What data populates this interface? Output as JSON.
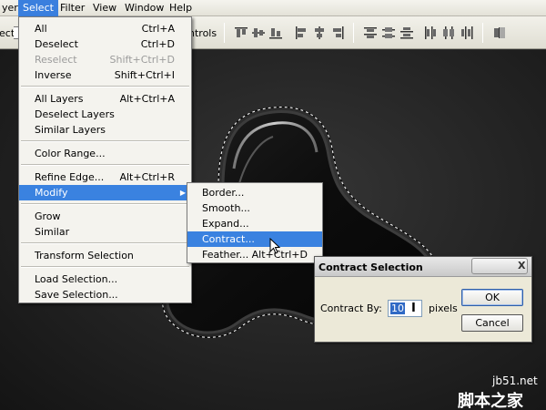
{
  "menubar": {
    "items": [
      {
        "label": "yer",
        "active": false
      },
      {
        "label": "Select",
        "active": true
      },
      {
        "label": "Filter",
        "active": false
      },
      {
        "label": "View",
        "active": false
      },
      {
        "label": "Window",
        "active": false
      },
      {
        "label": "Help",
        "active": false
      }
    ]
  },
  "toolbar": {
    "left_label": "ect:",
    "right_label": "ntrols"
  },
  "select_menu": {
    "items": [
      {
        "label": "All",
        "shortcut": "Ctrl+A"
      },
      {
        "label": "Deselect",
        "shortcut": "Ctrl+D"
      },
      {
        "label": "Reselect",
        "shortcut": "Shift+Ctrl+D"
      },
      {
        "label": "Inverse",
        "shortcut": "Shift+Ctrl+I"
      },
      {
        "label": "All Layers",
        "shortcut": "Alt+Ctrl+A"
      },
      {
        "label": "Deselect Layers",
        "shortcut": ""
      },
      {
        "label": "Similar Layers",
        "shortcut": ""
      },
      {
        "label": "Color Range...",
        "shortcut": ""
      },
      {
        "label": "Refine Edge...",
        "shortcut": "Alt+Ctrl+R"
      },
      {
        "label": "Modify",
        "shortcut": ""
      },
      {
        "label": "Grow",
        "shortcut": ""
      },
      {
        "label": "Similar",
        "shortcut": ""
      },
      {
        "label": "Transform Selection",
        "shortcut": ""
      },
      {
        "label": "Load Selection...",
        "shortcut": ""
      },
      {
        "label": "Save Selection...",
        "shortcut": ""
      }
    ]
  },
  "modify_menu": {
    "items": [
      {
        "label": "Border..."
      },
      {
        "label": "Smooth..."
      },
      {
        "label": "Expand..."
      },
      {
        "label": "Contract..."
      },
      {
        "label": "Feather...",
        "shortcut": "Alt+Ctrl+D"
      }
    ]
  },
  "dialog": {
    "title": "Contract Selection",
    "close_label": "X",
    "field_label": "Contract By:",
    "field_value": "10",
    "unit": "pixels",
    "ok_label": "OK",
    "cancel_label": "Cancel"
  },
  "watermark": {
    "line1": "jb51.net",
    "line2": "脚本之家"
  },
  "colors": {
    "menu_highlight": "#3a82e0",
    "menubar_active": "#3a7fde",
    "dialog_bg": "#ece9d8",
    "canvas_bg": "#2a2a2a"
  }
}
